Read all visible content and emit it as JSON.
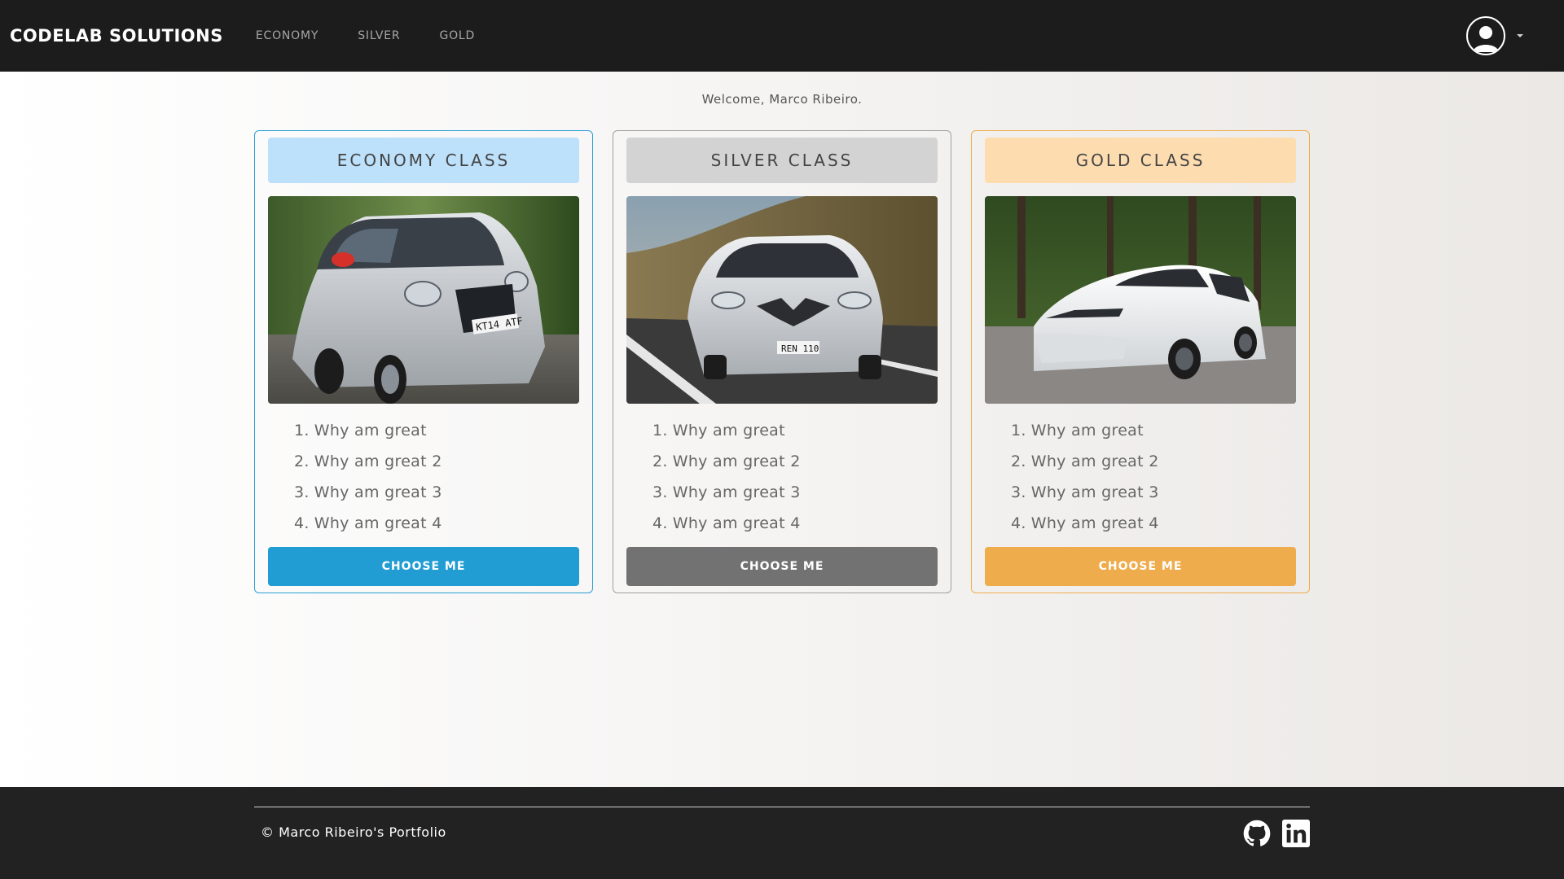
{
  "navbar": {
    "brand": "CODELAB SOLUTIONS",
    "links": [
      {
        "label": "ECONOMY"
      },
      {
        "label": "SILVER"
      },
      {
        "label": "GOLD"
      }
    ],
    "user_icon": "user-circle-icon",
    "caret_icon": "caret-down-icon"
  },
  "welcome": "Welcome, Marco Ribeiro.",
  "cards": [
    {
      "title": "ECONOMY CLASS",
      "features": [
        {
          "num": "1.",
          "text": "Why am great"
        },
        {
          "num": "2.",
          "text": "Why am great 2"
        },
        {
          "num": "3.",
          "text": "Why am great 3"
        },
        {
          "num": "4.",
          "text": "Why am great 4"
        }
      ],
      "button": "CHOOSE ME",
      "plate": "KT14 ATF",
      "accent": "#219dd4"
    },
    {
      "title": "SILVER CLASS",
      "features": [
        {
          "num": "1.",
          "text": "Why am great"
        },
        {
          "num": "2.",
          "text": "Why am great 2"
        },
        {
          "num": "3.",
          "text": "Why am great 3"
        },
        {
          "num": "4.",
          "text": "Why am great 4"
        }
      ],
      "button": "CHOOSE ME",
      "plate": "REN 110",
      "accent": "#727272"
    },
    {
      "title": "GOLD CLASS",
      "features": [
        {
          "num": "1.",
          "text": "Why am great"
        },
        {
          "num": "2.",
          "text": "Why am great 2"
        },
        {
          "num": "3.",
          "text": "Why am great 3"
        },
        {
          "num": "4.",
          "text": "Why am great 4"
        }
      ],
      "button": "CHOOSE ME",
      "accent": "#efac4c"
    }
  ],
  "footer": {
    "copyright": "© Marco Ribeiro's Portfolio",
    "socials": [
      {
        "icon": "github-icon"
      },
      {
        "icon": "linkedin-icon"
      }
    ]
  }
}
